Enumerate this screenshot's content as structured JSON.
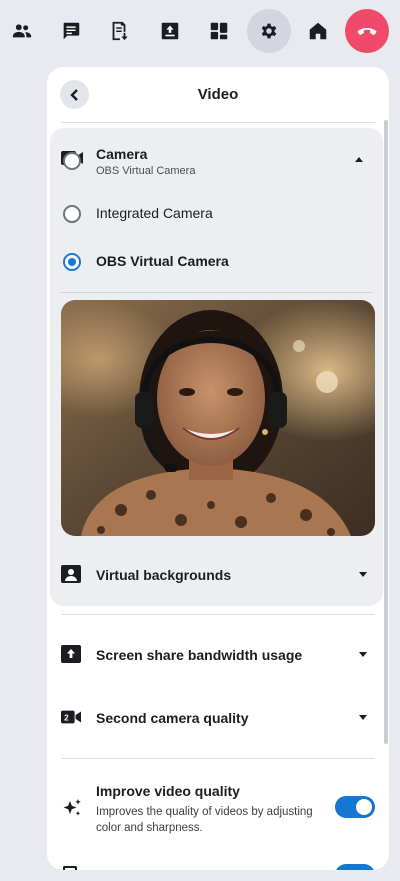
{
  "toolbar": {
    "items": [
      {
        "icon": "people-icon",
        "label": "Participants"
      },
      {
        "icon": "chat-icon",
        "label": "Chat"
      },
      {
        "icon": "notes-icon",
        "label": "Notes"
      },
      {
        "icon": "share-screen-icon",
        "label": "Share"
      },
      {
        "icon": "apps-grid-icon",
        "label": "Apps"
      },
      {
        "icon": "gear-icon",
        "label": "Settings",
        "active": true
      },
      {
        "icon": "home-icon",
        "label": "Home"
      },
      {
        "icon": "hangup-icon",
        "label": "Leave"
      }
    ],
    "hangup_color": "#f0496a"
  },
  "panel": {
    "title": "Video",
    "camera": {
      "title": "Camera",
      "selected": "OBS Virtual Camera",
      "options": [
        {
          "label": "Integrated Camera",
          "checked": false
        },
        {
          "label": "OBS Virtual Camera",
          "checked": true
        }
      ]
    },
    "settings": [
      {
        "label": "Virtual backgrounds",
        "icon": "portrait-icon"
      },
      {
        "label": "Screen share bandwidth usage",
        "icon": "upload-icon"
      },
      {
        "label": "Second camera quality",
        "icon": "second-camera-icon"
      }
    ],
    "improve_quality": {
      "title": "Improve video quality",
      "description": "Improves the quality of videos by adjusting color and sharpness.",
      "enabled": true
    }
  },
  "colors": {
    "accent": "#1677d2",
    "background": "#e8eaef",
    "panel": "#ffffff",
    "camera_section": "#eceef2"
  }
}
